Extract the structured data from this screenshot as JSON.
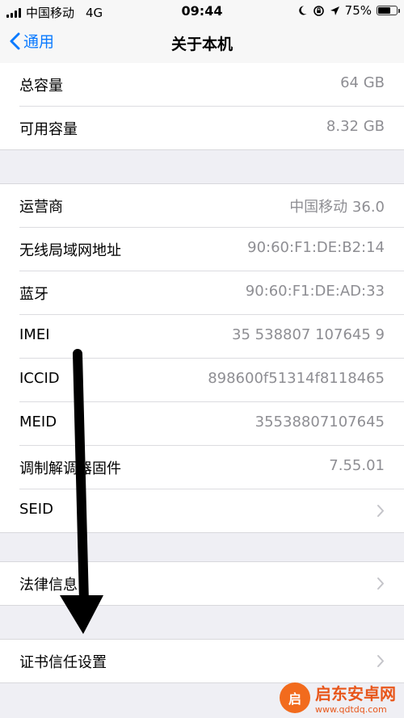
{
  "status": {
    "carrier": "中国移动",
    "network": "4G",
    "time": "09:44",
    "battery": "75%",
    "battery_level": 0.75
  },
  "nav": {
    "back_label": "通用",
    "title": "关于本机"
  },
  "storage": [
    {
      "label": "总容量",
      "value": "64 GB"
    },
    {
      "label": "可用容量",
      "value": "8.32 GB"
    }
  ],
  "network_info": [
    {
      "label": "运营商",
      "value": "中国移动 36.0"
    },
    {
      "label": "无线局域网地址",
      "value": "90:60:F1:DE:B2:14"
    },
    {
      "label": "蓝牙",
      "value": "90:60:F1:DE:AD:33"
    },
    {
      "label": "IMEI",
      "value": "35 538807 107645 9"
    },
    {
      "label": "ICCID",
      "value": "898600f51314f8118465"
    },
    {
      "label": "MEID",
      "value": "35538807107645"
    },
    {
      "label": "调制解调器固件",
      "value": "7.55.01"
    },
    {
      "label": "SEID",
      "value": ""
    }
  ],
  "legal": {
    "label": "法律信息"
  },
  "cert": {
    "label": "证书信任设置"
  },
  "watermark": {
    "logo": "启",
    "name": "启东安卓网",
    "url": "www.qdtdq.com"
  },
  "colors": {
    "accent": "#0a7aff",
    "secondary_text": "#8e8e93",
    "background": "#efeff4"
  }
}
